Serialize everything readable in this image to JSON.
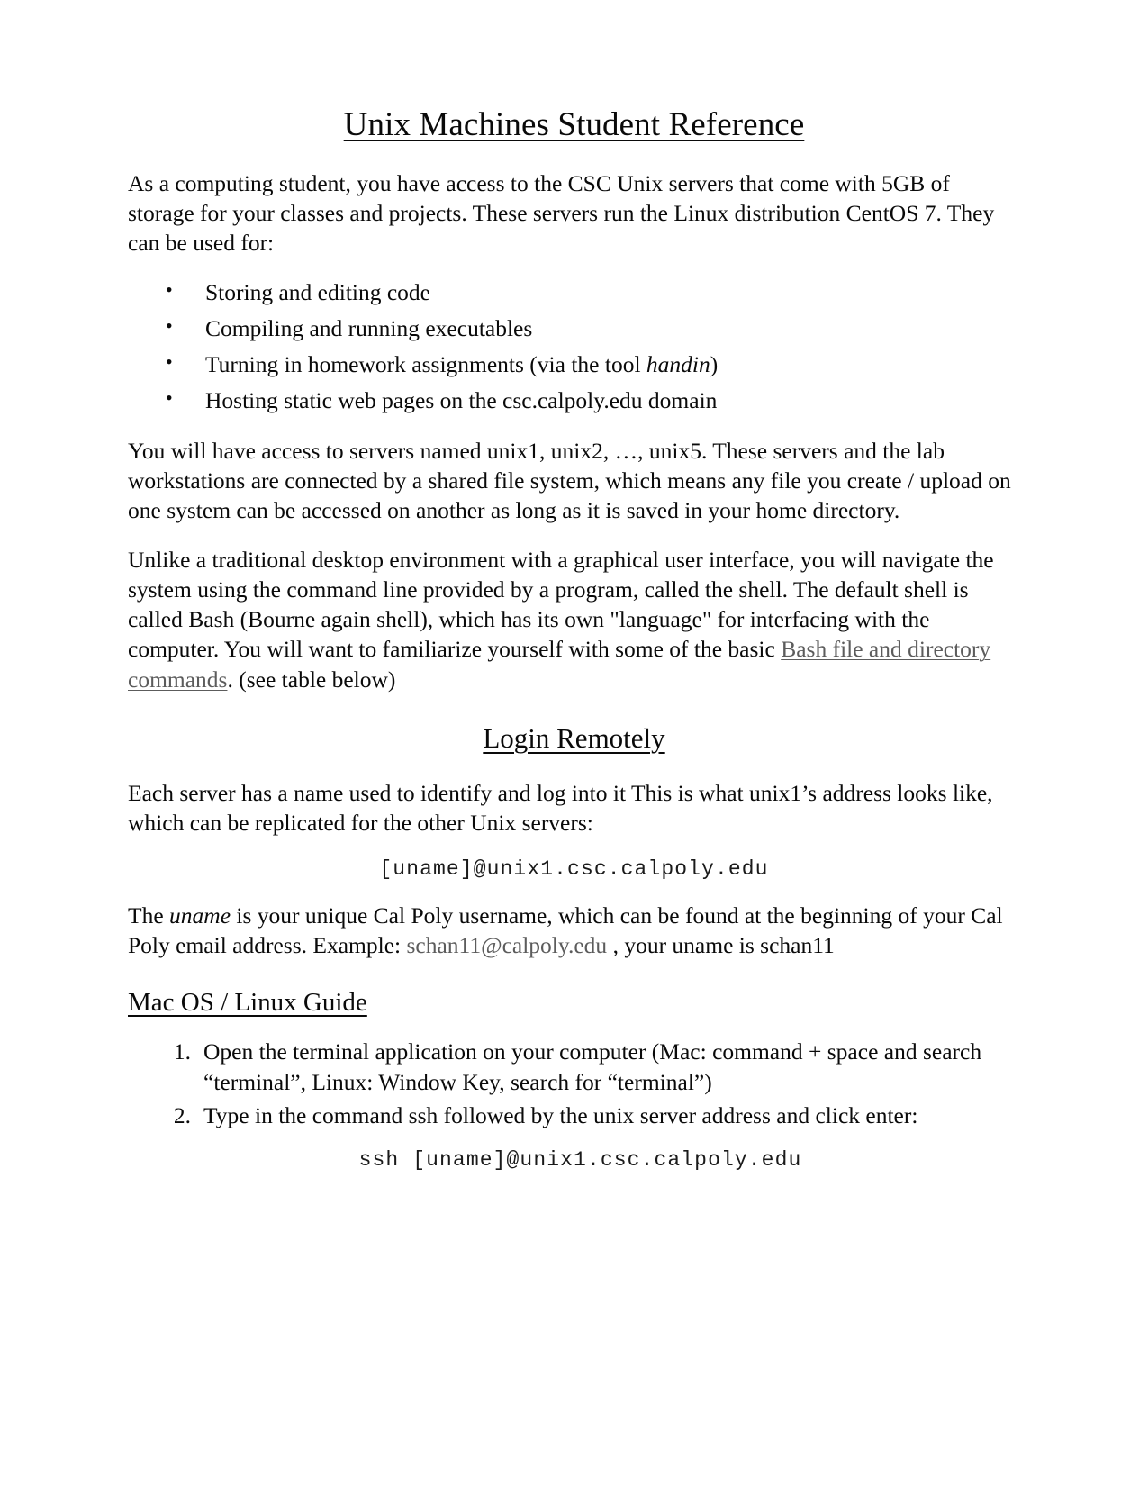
{
  "document": {
    "title": "Unix Machines Student Reference",
    "intro": {
      "part1": "As a computing student, you have access to the CSC Unix servers that come with 5GB of storage for your classes and projects. These servers run the Linux distribution CentOS 7. They can be used for:"
    },
    "uses_list": [
      {
        "text": "Storing and editing code"
      },
      {
        "before": "Turning in homework assignments (via the tool ",
        "italic": "handin",
        "after": ")"
      },
      {
        "text": "Compiling and running executables"
      },
      {
        "text": "Hosting static web pages on the csc.calpoly.edu domain"
      }
    ],
    "bullets": {
      "item1": "Storing and editing code",
      "item2": "Compiling and running executables",
      "item3_before": "Turning in homework assignments (via the tool ",
      "item3_italic": "handin",
      "item3_after": ")",
      "item4": "Hosting static web pages on the csc.calpoly.edu domain"
    },
    "servers_paragraph": "You will have access to servers named unix1, unix2, …, unix5. These servers and the lab workstations are connected by a shared file system, which means any file you create / upload on one system can be accessed on another as long as it is saved in your home directory.",
    "shell_paragraph": {
      "before_link": "Unlike a traditional desktop environment with a graphical user interface, you will navigate the system using the command line provided by a program, called the shell. The default shell is called Bash (Bourne again shell), which has its own \"language\" for interfacing with the computer. You will want to familiarize yourself with some of the basic ",
      "link_text": "Bash file and directory commands",
      "after_link": ". (see table below)"
    },
    "login_section": {
      "heading": "Login Remotely",
      "intro": "Each server has a name used to identify and log into it This is what unix1’s address looks like, which can be replicated for the other Unix servers:",
      "address_code": "[uname]@unix1.csc.calpoly.edu",
      "uname_paragraph": {
        "before_italic": "The ",
        "italic": "uname",
        "after_italic": " is your unique Cal Poly username, which can be found at the beginning of your Cal Poly email address. Example: ",
        "email_link": "schan11@calpoly.edu",
        "after_link": " , your uname is schan11"
      }
    },
    "mac_linux_section": {
      "heading": "Mac OS / Linux Guide",
      "steps": {
        "step1": "Open the terminal application on your computer (Mac: command + space and search “terminal”, Linux: Window Key, search for “terminal”)",
        "step2": "Type in the command ssh followed by the unix server address and click enter:"
      },
      "ssh_code": "ssh [uname]@unix1.csc.calpoly.edu"
    },
    "colors": {
      "text": "#0a0a0a",
      "link": "#5c5c5c",
      "background": "#ffffff"
    }
  }
}
